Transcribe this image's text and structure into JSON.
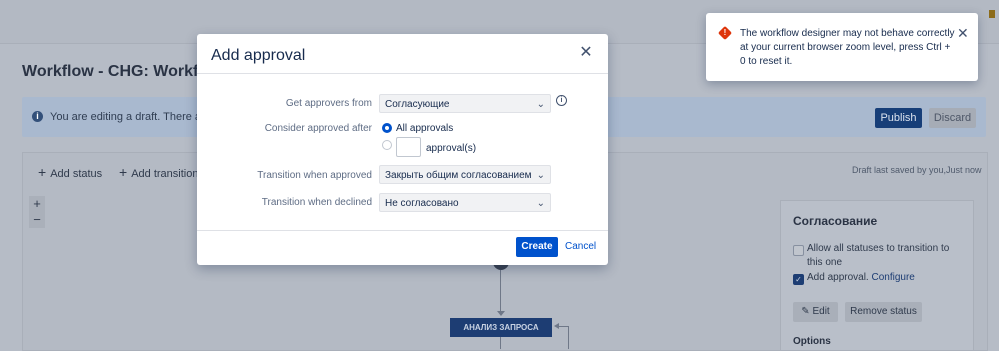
{
  "background": {
    "page_title": "Workflow - CHG: Workflow (",
    "edit_banner_text": "You are editing a draft. There are u",
    "publish_label": "Publish",
    "discard_label": "Discard",
    "toolbar": {
      "add_status": "Add status",
      "add_transition": "Add transition"
    },
    "draft_note": "Draft last saved by you,Just now",
    "zoom_in": "+",
    "zoom_out": "−",
    "status_node_label": "АНАЛИЗ ЗАПРОСА",
    "side_panel": {
      "title": "Согласование",
      "allow_all_label": "Allow all statuses to transition to this one",
      "add_approval_label": "Add approval.",
      "configure_link": "Configure",
      "edit_button": "Edit",
      "remove_status_button": "Remove status",
      "options_heading": "Options"
    }
  },
  "modal": {
    "title": "Add approval",
    "fields": {
      "get_approvers_label": "Get approvers from",
      "get_approvers_value": "Согласующие",
      "consider_approved_label": "Consider approved after",
      "option_all": "All approvals",
      "option_count_suffix": "approval(s)",
      "transition_approved_label": "Transition when approved",
      "transition_approved_value": "Закрыть общим согласованием",
      "transition_declined_label": "Transition when declined",
      "transition_declined_value": "Не согласовано"
    },
    "create_label": "Create",
    "cancel_label": "Cancel"
  },
  "toast": {
    "message": "The workflow designer may not behave correctly at your current browser zoom level, press Ctrl + 0 to reset it."
  },
  "colors": {
    "primary": "#0052cc",
    "error": "#de350b",
    "overlay": "#b6bcc6"
  }
}
